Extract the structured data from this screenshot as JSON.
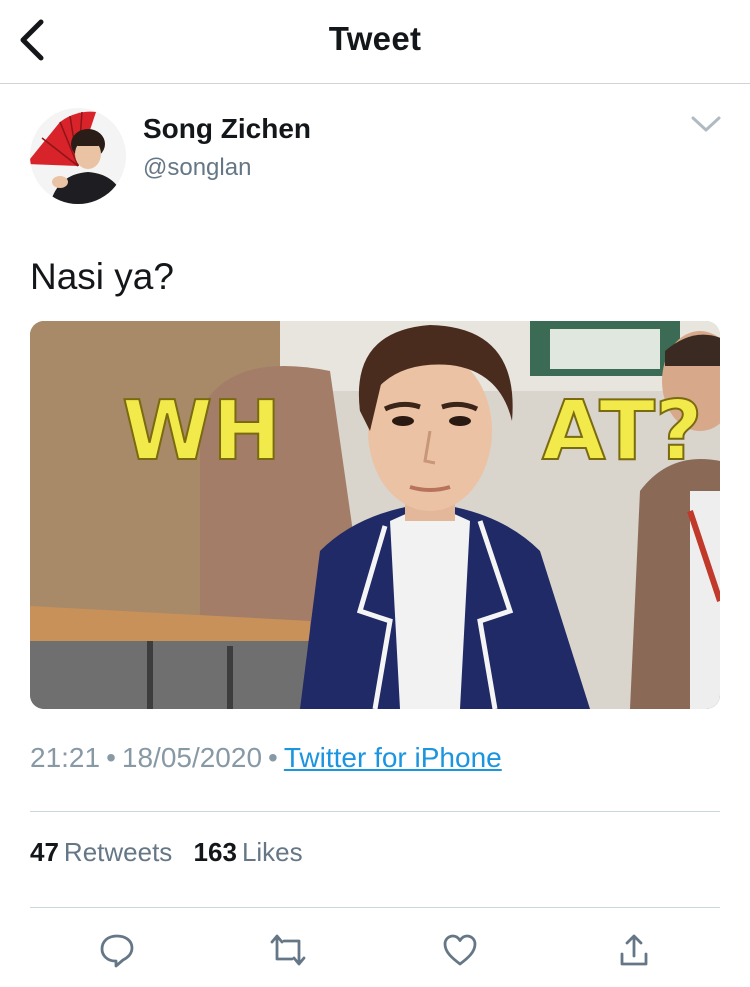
{
  "header": {
    "title": "Tweet",
    "back_icon": "chevron-left-icon"
  },
  "author": {
    "name": "Song Zichen",
    "handle": "@songlan"
  },
  "tweet": {
    "text": "Nasi ya?",
    "media_overlay": {
      "left_text": "WH",
      "right_text": "AT?"
    }
  },
  "meta": {
    "time": "21:21",
    "date": "18/05/2020",
    "separator": "•",
    "source": "Twitter for iPhone"
  },
  "stats": {
    "retweets_count": "47",
    "retweets_label": "Retweets",
    "likes_count": "163",
    "likes_label": "Likes"
  },
  "actions": [
    "reply-icon",
    "retweet-icon",
    "like-icon",
    "share-icon"
  ],
  "colors": {
    "link": "#1b95e0",
    "secondary_text": "#657786",
    "meta_text": "#8899a6",
    "divider": "#ccd6dd",
    "icon": "#657786",
    "media_text": "#f2ea4a"
  }
}
